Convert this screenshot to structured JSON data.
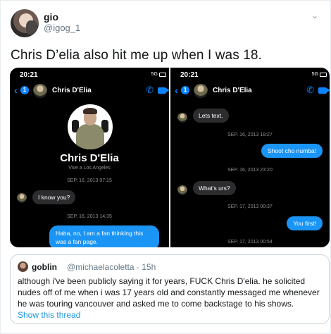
{
  "author": {
    "name": "gio",
    "handle": "@igog_1"
  },
  "tweet": {
    "text": "Chris D’elia also hit me up when I was 18."
  },
  "media": {
    "left": {
      "time": "20:21",
      "signal": "5G",
      "chat_name": "Chris D'Elia",
      "badge": "1",
      "profile_name": "Chris D'Elia",
      "profile_location": "Vive a Los Angeles",
      "messages": [
        {
          "kind": "timestamp",
          "text": "SEP. 16, 2013 07:15"
        },
        {
          "kind": "in",
          "text": "I know you?"
        },
        {
          "kind": "timestamp",
          "text": "SEP. 16, 2013 14:35"
        },
        {
          "kind": "out",
          "text": "Haha, no, I am a fan thinking this was a fan page."
        }
      ]
    },
    "right": {
      "time": "20:21",
      "signal": "5G",
      "chat_name": "Chris D'Elia",
      "badge": "1",
      "messages": [
        {
          "kind": "in",
          "text": "Lets text."
        },
        {
          "kind": "timestamp",
          "text": "SEP. 16, 2013 18:27"
        },
        {
          "kind": "out",
          "text": "Shoot cho numba!"
        },
        {
          "kind": "timestamp",
          "text": "SEP. 16, 2013 23:20"
        },
        {
          "kind": "in",
          "text": "What's urs?"
        },
        {
          "kind": "timestamp",
          "text": "SEP. 17, 2013 00:37"
        },
        {
          "kind": "out",
          "text": "You first!"
        },
        {
          "kind": "timestamp",
          "text": "SEP. 17, 2013 00:54"
        }
      ]
    }
  },
  "quote": {
    "name": "goblin",
    "handle": "@michaelacoletta · 15h",
    "text": "although i've been publicly saying it for years, FUCK Chris D'elia. he solicited nudes off of me when i was 17 years old and constantly messaged me whenever he was touring vancouver and asked me to come backstage to his shows.",
    "show_thread": "Show this thread"
  },
  "icons": {
    "back": "chevron-left-icon",
    "call": "phone-icon",
    "video": "video-camera-icon",
    "menu": "chevron-down-icon"
  },
  "colors": {
    "link": "#1b95e0",
    "ios_blue": "#0a84ff",
    "bubble_out": "#1b95f5",
    "bubble_in": "#2c2c2e"
  }
}
